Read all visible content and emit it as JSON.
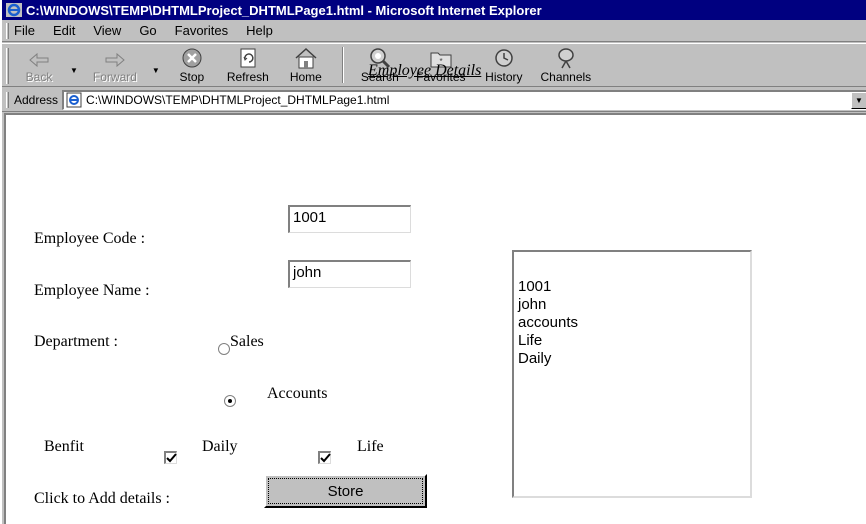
{
  "window": {
    "title": "C:\\WINDOWS\\TEMP\\DHTMLProject_DHTMLPage1.html - Microsoft Internet Explorer"
  },
  "menu": {
    "items": [
      "File",
      "Edit",
      "View",
      "Go",
      "Favorites",
      "Help"
    ]
  },
  "toolbar": {
    "back": "Back",
    "forward": "Forward",
    "stop": "Stop",
    "refresh": "Refresh",
    "home": "Home",
    "search": "Search",
    "favorites": "Favorites",
    "history": "History",
    "channels": "Channels"
  },
  "address": {
    "label": "Address",
    "url": "C:\\WINDOWS\\TEMP\\DHTMLProject_DHTMLPage1.html"
  },
  "form": {
    "heading": "Employee Details",
    "employee_code_label": "Employee Code :",
    "employee_code_value": "1001",
    "employee_name_label": "Employee Name :",
    "employee_name_value": "john",
    "department_label": "Department :",
    "department_options": [
      "Sales",
      "Accounts"
    ],
    "department_selected": "Accounts",
    "benefit_label": "Benfit",
    "benefit_options": [
      "Daily",
      "Life"
    ],
    "benefit_checked": [
      "Daily",
      "Life"
    ],
    "store_prompt": "Click to Add details :",
    "store_button": "Store"
  },
  "details_list": {
    "lines": [
      "1001",
      "john",
      "accounts",
      "Life",
      "Daily"
    ]
  },
  "colors": {
    "titlebar": "#000080",
    "chrome": "#c0c0c0"
  }
}
